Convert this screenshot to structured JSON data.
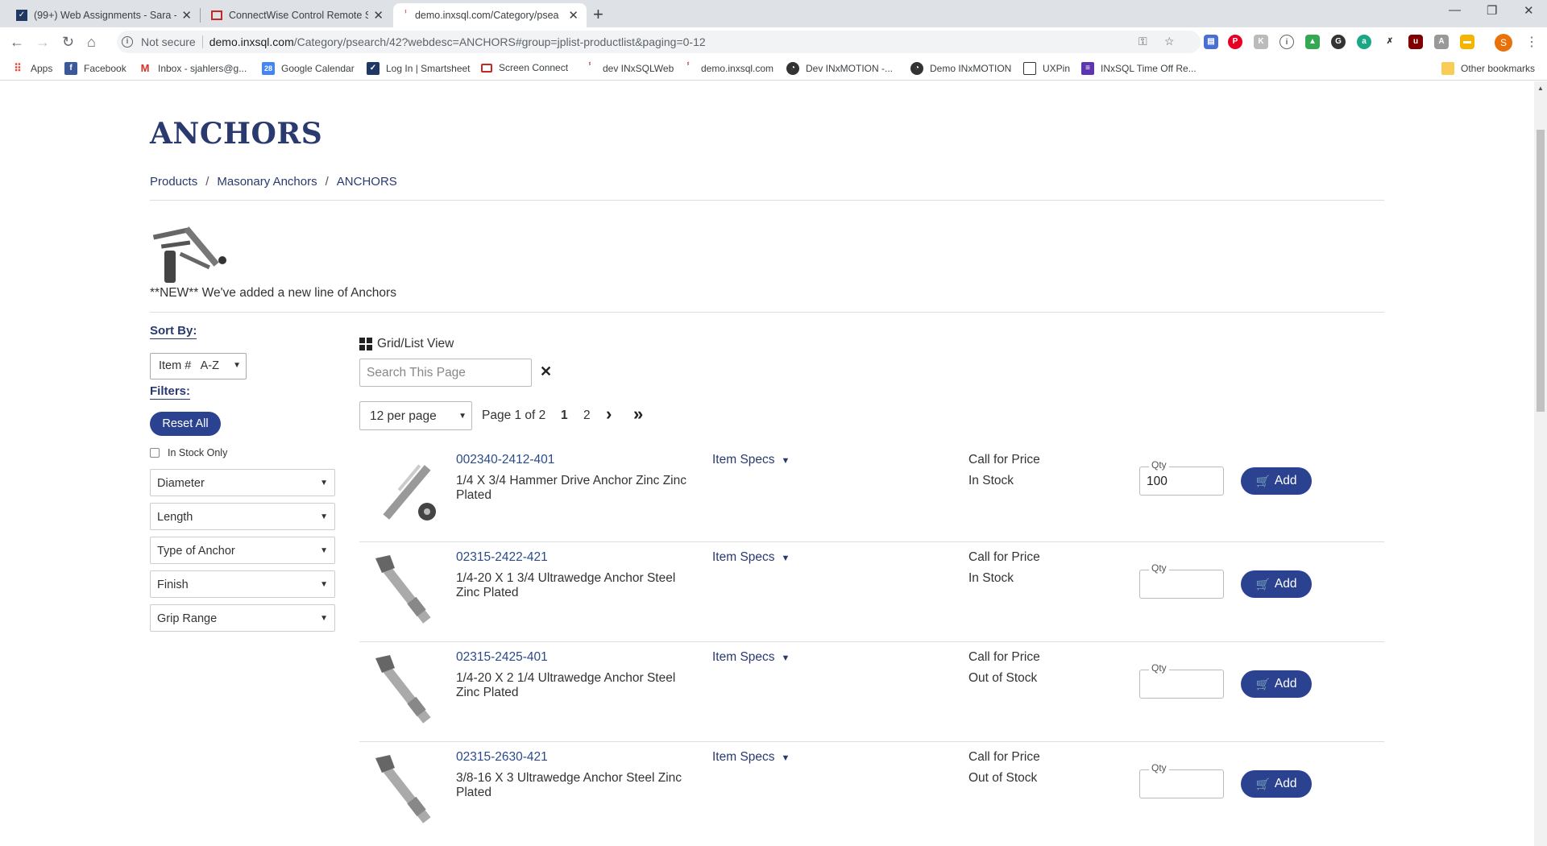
{
  "browser": {
    "tabs": [
      {
        "title": "(99+) Web Assignments - Sara -",
        "active": false
      },
      {
        "title": "ConnectWise Control Remote Su",
        "active": false
      },
      {
        "title": "demo.inxsql.com/Category/psea",
        "active": true
      }
    ],
    "address": {
      "security": "Not secure",
      "host": "demo.inxsql.com",
      "path": "/Category/psearch/42?webdesc=ANCHORS#group=jplist-productlist&paging=0-12"
    },
    "profile_initial": "S",
    "bookmarks": [
      "Apps",
      "Facebook",
      "Inbox - sjahlers@g...",
      "Google Calendar",
      "Log In | Smartsheet",
      "Screen Connect",
      "dev INxSQLWeb",
      "demo.inxsql.com",
      "Dev INxMOTION -...",
      "Demo INxMOTION",
      "UXPin",
      "INxSQL Time Off Re..."
    ],
    "other_bookmarks": "Other bookmarks"
  },
  "page": {
    "title": "ANCHORS",
    "breadcrumb": [
      "Products",
      "Masonary Anchors",
      "ANCHORS"
    ],
    "promo_text": "**NEW** We've added a new line of Anchors"
  },
  "sidebar": {
    "sort_label": "Sort By:",
    "sort_value": "Item #   A-Z",
    "filters_label": "Filters:",
    "reset_label": "Reset All",
    "in_stock_label": "In Stock Only",
    "filters": [
      "Diameter",
      "Length",
      "Type of Anchor",
      "Finish",
      "Grip Range"
    ]
  },
  "listing": {
    "view_label": "Grid/List View",
    "search_placeholder": "Search This Page",
    "per_page": "12 per page",
    "page_info": "Page 1 of 2",
    "pages": [
      "1",
      "2"
    ],
    "specs_label": "Item Specs",
    "qty_label": "Qty",
    "add_label": "Add",
    "products": [
      {
        "sku": "002340-2412-401",
        "desc": "1/4 X 3/4 Hammer Drive Anchor Zinc Zinc Plated",
        "price": "Call for Price",
        "stock": "In Stock",
        "qty": "100"
      },
      {
        "sku": "02315-2422-421",
        "desc": "1/4-20 X 1 3/4 Ultrawedge Anchor Steel Zinc Plated",
        "price": "Call for Price",
        "stock": "In Stock",
        "qty": ""
      },
      {
        "sku": "02315-2425-401",
        "desc": "1/4-20 X 2 1/4 Ultrawedge Anchor Steel Zinc Plated",
        "price": "Call for Price",
        "stock": "Out of Stock",
        "qty": ""
      },
      {
        "sku": "02315-2630-421",
        "desc": "3/8-16 X 3 Ultrawedge Anchor Steel Zinc Plated",
        "price": "Call for Price",
        "stock": "Out of Stock",
        "qty": ""
      }
    ]
  },
  "colors": {
    "brand_navy": "#2a3a6e",
    "button_blue": "#2b4290",
    "link_blue": "#2a4a8a"
  }
}
